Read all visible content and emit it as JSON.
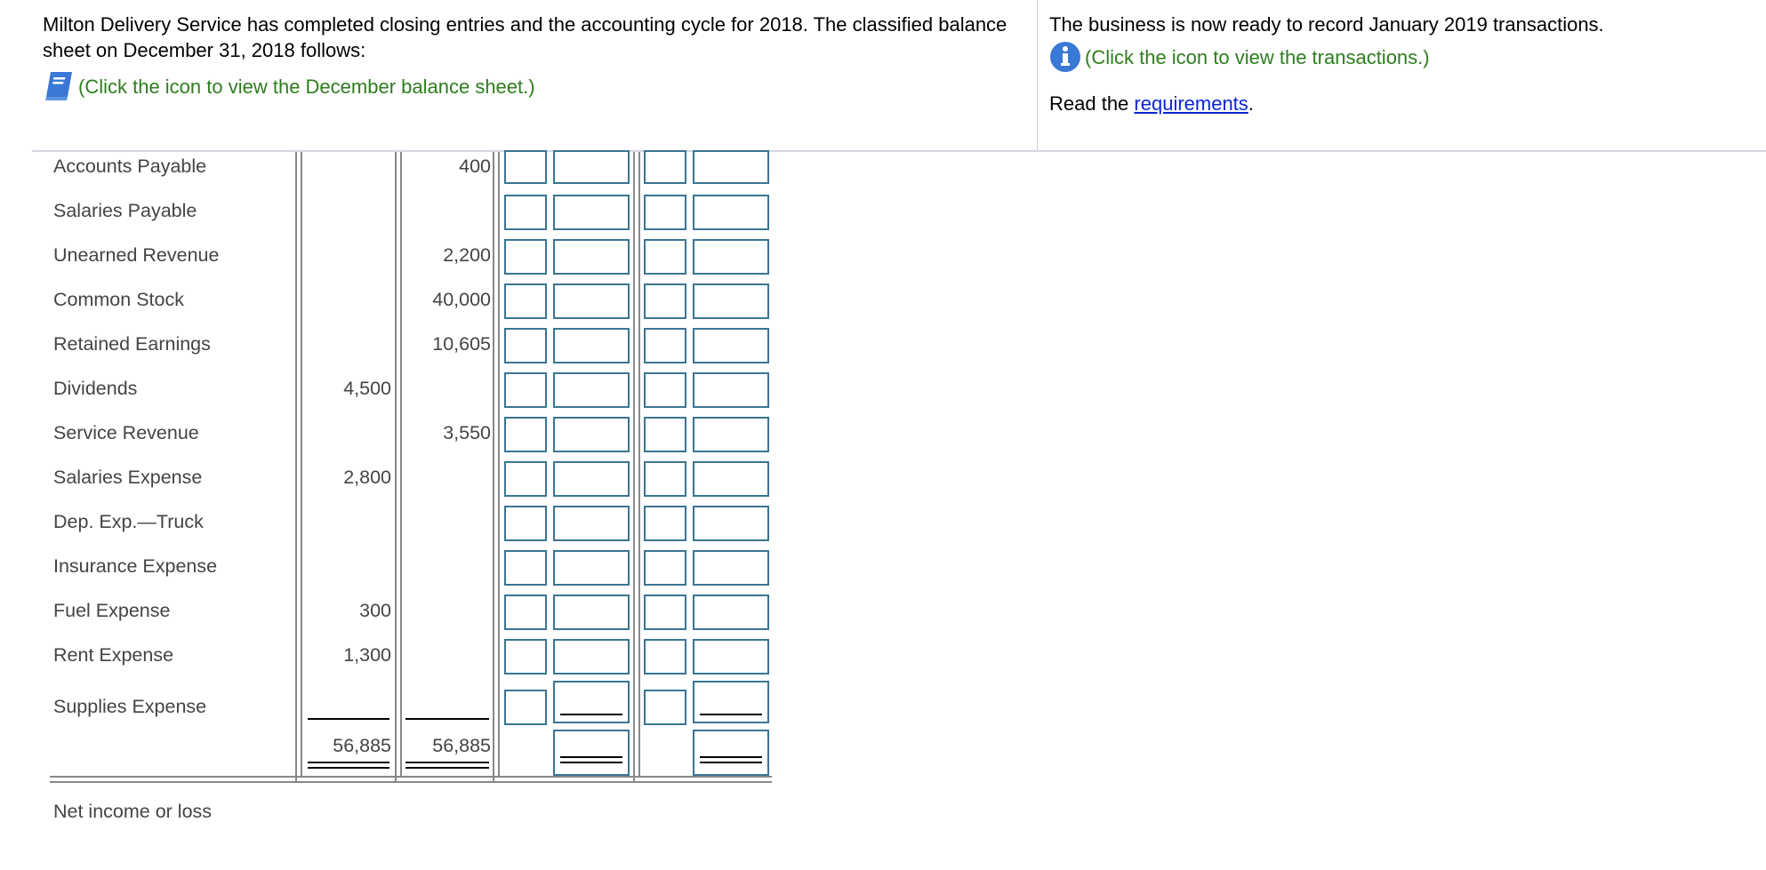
{
  "header": {
    "intro_text": "Milton Delivery Service has completed closing entries and the accounting cycle for 2018. The classified balance sheet on December 31, 2018 follows:",
    "balance_sheet_link": "(Click the icon to view the December balance sheet.)",
    "balance_sheet_icon": "book-icon",
    "ready_text": "The business is now ready to record January 2019 transactions.",
    "transactions_link": "(Click the icon to view the transactions.)",
    "transactions_icon": "info-icon",
    "read_prefix": "Read the ",
    "requirements_link": "requirements",
    "read_suffix": "."
  },
  "worksheet": {
    "rows": [
      {
        "account": "Accounts Payable",
        "debit": "",
        "credit": "400"
      },
      {
        "account": "Salaries Payable",
        "debit": "",
        "credit": ""
      },
      {
        "account": "Unearned Revenue",
        "debit": "",
        "credit": "2,200"
      },
      {
        "account": "Common Stock",
        "debit": "",
        "credit": "40,000"
      },
      {
        "account": "Retained Earnings",
        "debit": "",
        "credit": "10,605"
      },
      {
        "account": "Dividends",
        "debit": "4,500",
        "credit": ""
      },
      {
        "account": "Service Revenue",
        "debit": "",
        "credit": "3,550"
      },
      {
        "account": "Salaries Expense",
        "debit": "2,800",
        "credit": ""
      },
      {
        "account": "Dep. Exp.—Truck",
        "debit": "",
        "credit": ""
      },
      {
        "account": "Insurance Expense",
        "debit": "",
        "credit": ""
      },
      {
        "account": "Fuel Expense",
        "debit": "300",
        "credit": ""
      },
      {
        "account": "Rent Expense",
        "debit": "1,300",
        "credit": ""
      },
      {
        "account": "Supplies Expense",
        "debit": "",
        "credit": ""
      }
    ],
    "totals": {
      "debit": "56,885",
      "credit": "56,885"
    },
    "net_income_label": "Net income or loss"
  }
}
